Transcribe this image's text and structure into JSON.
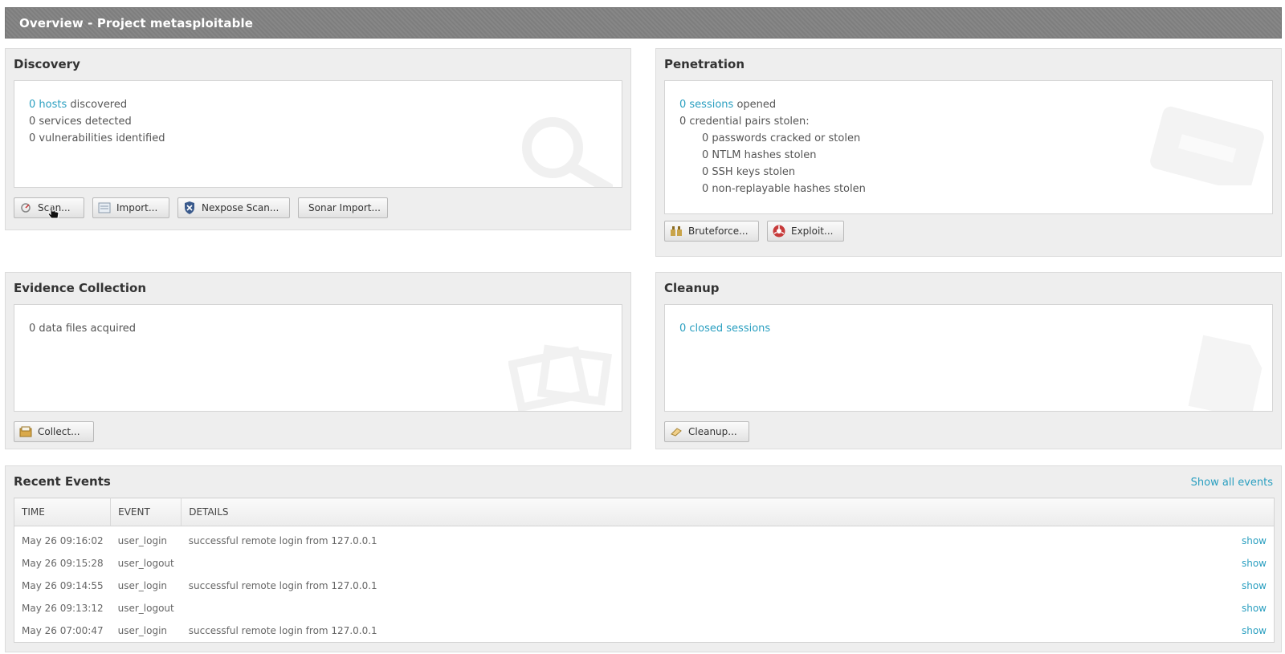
{
  "header": {
    "title": "Overview - Project metasploitable"
  },
  "discovery": {
    "title": "Discovery",
    "hosts_count": "0 hosts",
    "hosts_suffix": " discovered",
    "services": "0 services detected",
    "vulns": "0 vulnerabilities identified",
    "buttons": {
      "scan": "Scan...",
      "import": "Import...",
      "nexpose": "Nexpose Scan...",
      "sonar": "Sonar Import..."
    }
  },
  "penetration": {
    "title": "Penetration",
    "sessions_count": "0 sessions",
    "sessions_suffix": " opened",
    "creds": "0 credential pairs stolen:",
    "passwords": "0 passwords cracked or stolen",
    "ntlm": "0 NTLM hashes stolen",
    "ssh": "0 SSH keys stolen",
    "nonreplay": "0 non-replayable hashes stolen",
    "buttons": {
      "bruteforce": "Bruteforce...",
      "exploit": "Exploit..."
    }
  },
  "evidence": {
    "title": "Evidence Collection",
    "files": "0 data files acquired",
    "buttons": {
      "collect": "Collect..."
    }
  },
  "cleanup": {
    "title": "Cleanup",
    "closed": "0 closed sessions",
    "buttons": {
      "cleanup": "Cleanup..."
    }
  },
  "events": {
    "title": "Recent Events",
    "show_all": "Show all events",
    "columns": {
      "time": "TIME",
      "event": "EVENT",
      "details": "DETAILS"
    },
    "rows": [
      {
        "time": "May 26 09:16:02",
        "event": "user_login",
        "details": "successful remote login from 127.0.0.1",
        "action": "show"
      },
      {
        "time": "May 26 09:15:28",
        "event": "user_logout",
        "details": "",
        "action": "show"
      },
      {
        "time": "May 26 09:14:55",
        "event": "user_login",
        "details": "successful remote login from 127.0.0.1",
        "action": "show"
      },
      {
        "time": "May 26 09:13:12",
        "event": "user_logout",
        "details": "",
        "action": "show"
      },
      {
        "time": "May 26 07:00:47",
        "event": "user_login",
        "details": "successful remote login from 127.0.0.1",
        "action": "show"
      }
    ]
  },
  "colors": {
    "link": "#2a9fc0",
    "header_bg": "#828282",
    "panel_bg": "#eeeeee"
  }
}
